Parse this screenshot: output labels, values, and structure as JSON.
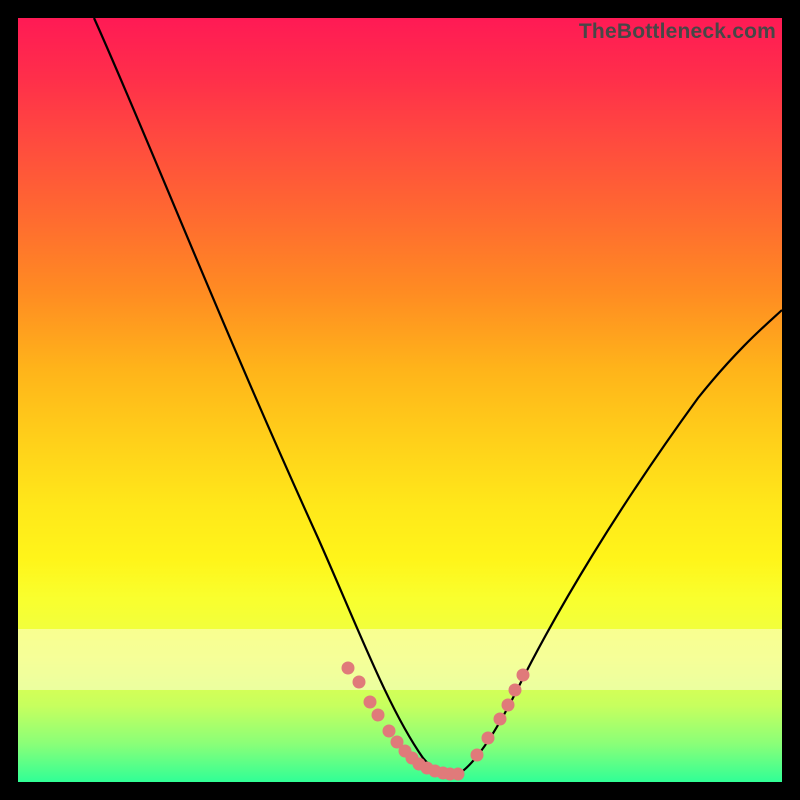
{
  "watermark": "TheBottleneck.com",
  "chart_data": {
    "type": "line",
    "title": "",
    "xlabel": "",
    "ylabel": "",
    "xlim": [
      0,
      100
    ],
    "ylim": [
      0,
      100
    ],
    "series": [
      {
        "name": "left-curve",
        "x": [
          10,
          15,
          20,
          25,
          30,
          35,
          40,
          45,
          48,
          50,
          52,
          54,
          56
        ],
        "y": [
          100,
          90,
          78,
          65,
          52,
          40,
          28,
          16,
          9,
          5,
          3,
          1.5,
          0.8
        ]
      },
      {
        "name": "right-curve",
        "x": [
          56,
          58,
          60,
          63,
          66,
          70,
          75,
          80,
          85,
          90,
          95,
          100
        ],
        "y": [
          0.8,
          1.5,
          3,
          6,
          10,
          16,
          24,
          32,
          40,
          48,
          55,
          62
        ]
      },
      {
        "name": "scatter-dots",
        "style": "dots",
        "color": "#d96a6a",
        "x": [
          43,
          44.5,
          46,
          47,
          48.5,
          49.5,
          50.5,
          51.5,
          52.5,
          53.5,
          54.5,
          55.5,
          56.5,
          57.5,
          60,
          61.5,
          63,
          64,
          65,
          66
        ],
        "y": [
          14,
          12,
          9.5,
          8,
          6,
          4.8,
          3.8,
          3,
          2.4,
          2,
          1.6,
          1.3,
          1.1,
          1.0,
          3,
          5,
          7.2,
          9,
          11,
          13
        ]
      }
    ],
    "band": {
      "y_from": 12,
      "y_to": 20
    }
  }
}
